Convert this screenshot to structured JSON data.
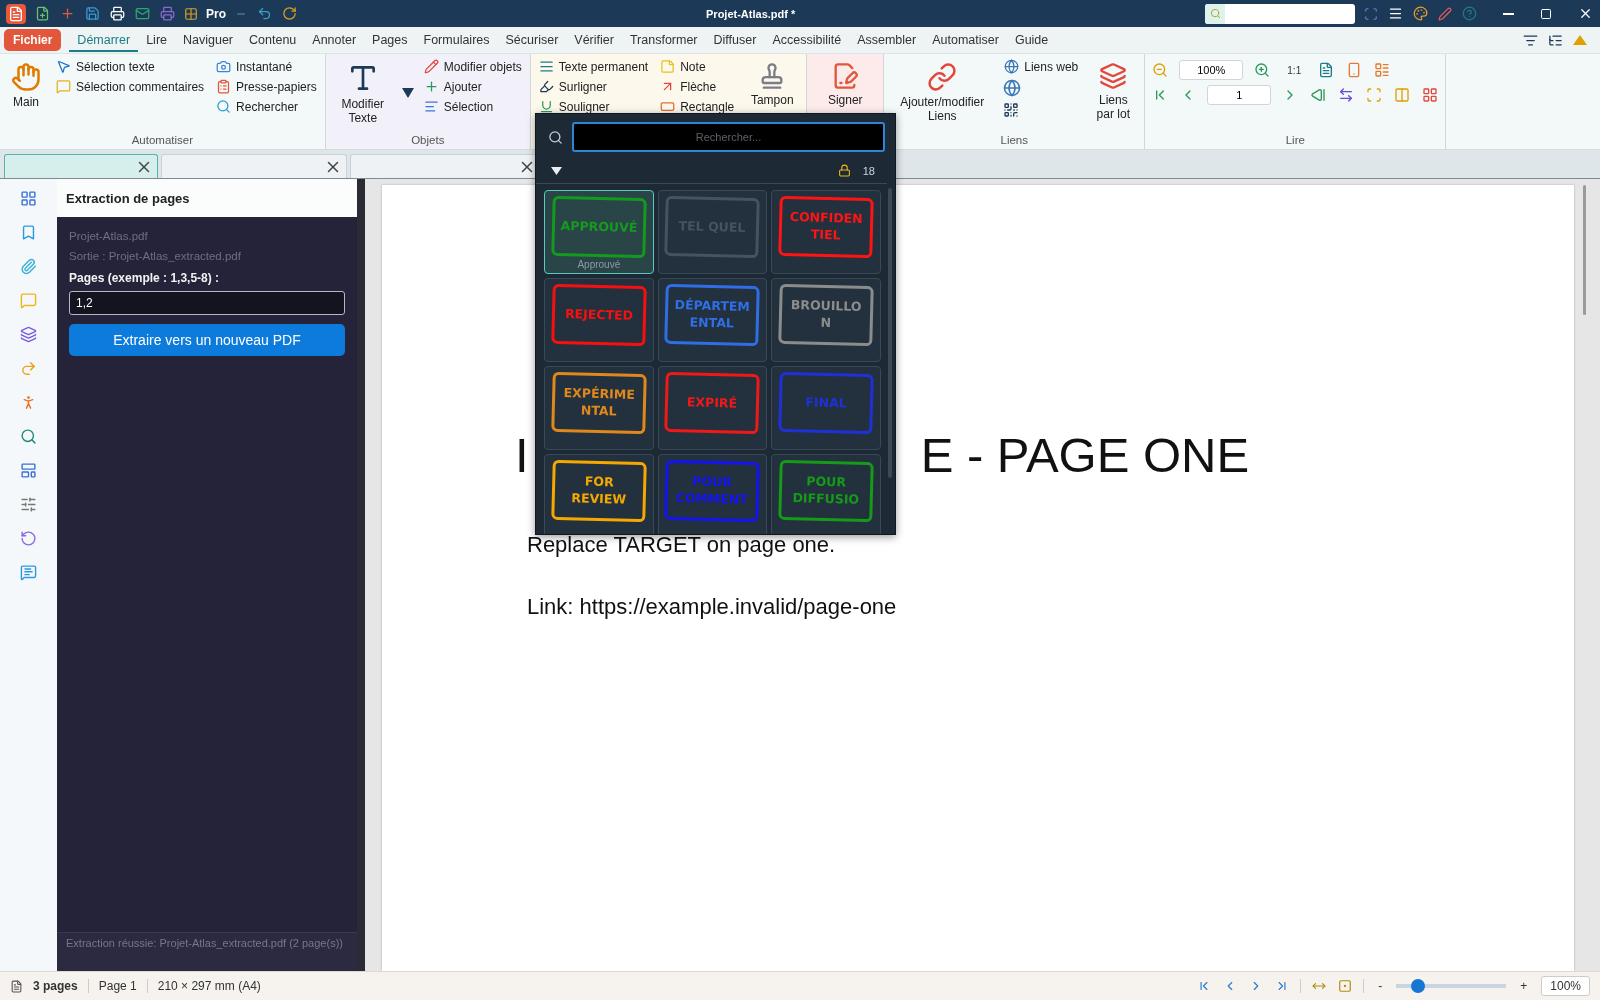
{
  "titlebar": {
    "edition": "Pro",
    "title": "Projet-Atlas.pdf *"
  },
  "menu": {
    "file_button": "Fichier",
    "items": [
      {
        "label": "Démarrer",
        "selected": true
      },
      {
        "label": "Lire",
        "selected": false
      },
      {
        "label": "Naviguer",
        "selected": false
      },
      {
        "label": "Contenu",
        "selected": false
      },
      {
        "label": "Annoter",
        "selected": false
      },
      {
        "label": "Pages",
        "selected": false
      },
      {
        "label": "Formulaires",
        "selected": false
      },
      {
        "label": "Sécuriser",
        "selected": false
      },
      {
        "label": "Vérifier",
        "selected": false
      },
      {
        "label": "Transformer",
        "selected": false
      },
      {
        "label": "Diffuser",
        "selected": false
      },
      {
        "label": "Accessibilité",
        "selected": false
      },
      {
        "label": "Assembler",
        "selected": false
      },
      {
        "label": "Automatiser",
        "selected": false
      },
      {
        "label": "Guide",
        "selected": false
      }
    ]
  },
  "ribbon": {
    "groups": [
      {
        "label": "Automatiser",
        "columns": [
          [
            {
              "kind": "large",
              "label": "Main"
            }
          ],
          [
            {
              "kind": "small",
              "label": "Sélection texte"
            },
            {
              "kind": "small",
              "label": "Sélection commentaires"
            }
          ],
          [
            {
              "kind": "small",
              "label": "Instantané"
            },
            {
              "kind": "small",
              "label": "Presse-papiers"
            },
            {
              "kind": "small",
              "label": "Rechercher"
            }
          ]
        ]
      },
      {
        "label": "Objets",
        "columns": [
          [
            {
              "kind": "large",
              "label": "Modifier Texte"
            }
          ],
          [
            {
              "kind": "dropdown"
            }
          ],
          [
            {
              "kind": "small",
              "label": "Modifier objets"
            },
            {
              "kind": "small",
              "label": "Ajouter"
            },
            {
              "kind": "small",
              "label": "Sélection"
            }
          ]
        ]
      },
      {
        "columns": [
          [
            {
              "kind": "small",
              "label": "Texte permanent"
            },
            {
              "kind": "small",
              "label": "Surligner"
            },
            {
              "kind": "small",
              "label": "Souligner"
            }
          ],
          [
            {
              "kind": "small",
              "label": "Note"
            },
            {
              "kind": "small",
              "label": "Flèche"
            },
            {
              "kind": "small",
              "label": "Rectangle"
            }
          ],
          [
            {
              "kind": "large",
              "label": "Tampon"
            }
          ]
        ]
      },
      {
        "columns": [
          [
            {
              "kind": "large",
              "label": "Signer"
            }
          ]
        ]
      },
      {
        "label": "Liens",
        "columns": [
          [
            {
              "kind": "large",
              "label": "Ajouter/modifier Liens"
            }
          ],
          [
            {
              "kind": "small",
              "label": "Liens web"
            },
            {
              "kind": "icon"
            },
            {
              "kind": "icon"
            }
          ],
          [
            {
              "kind": "large",
              "label": "Liens par lot"
            }
          ]
        ]
      },
      {
        "label": "Lire",
        "rows": [
          [
            {
              "kind": "icon"
            },
            {
              "kind": "field",
              "value": "100%"
            },
            {
              "kind": "icon"
            },
            {
              "kind": "text",
              "label": "1:1"
            },
            {
              "kind": "icon"
            },
            {
              "kind": "icon"
            },
            {
              "kind": "icon"
            }
          ],
          [
            {
              "kind": "icon"
            },
            {
              "kind": "icon"
            },
            {
              "kind": "field",
              "value": "1"
            },
            {
              "kind": "icon"
            },
            {
              "kind": "icon"
            },
            {
              "kind": "icon"
            },
            {
              "kind": "icon"
            },
            {
              "kind": "icon"
            },
            {
              "kind": "icon"
            }
          ]
        ]
      }
    ]
  },
  "doc_tabs": [
    {
      "selected": true
    },
    {
      "selected": false
    },
    {
      "selected": false
    }
  ],
  "panel": {
    "title": "Extraction de pages",
    "file": "Projet-Atlas.pdf",
    "output": "Sortie : Projet-Atlas_extracted.pdf",
    "pages_label": "Pages (exemple : 1,3,5-8) :",
    "pages_value": "1,2",
    "button": "Extraire vers un nouveau PDF",
    "status": "Extraction réussie: Projet-Atlas_extracted.pdf (2 page(s))"
  },
  "document": {
    "heading_left": "I",
    "heading_right": "E - PAGE ONE",
    "body": "Replace TARGET on page one.",
    "link": "Link: https://example.invalid/page-one"
  },
  "stamp_picker": {
    "placeholder": "Rechercher...",
    "count": "18",
    "stamps": [
      {
        "lines": [
          "APPROUVÉ"
        ],
        "color": "#149a1e",
        "selected": true,
        "caption": "Approuvé"
      },
      {
        "lines": [
          "TEL QUEL"
        ],
        "color": "#47525c",
        "selected": false
      },
      {
        "lines": [
          "CONFIDEN",
          "TIEL"
        ],
        "color": "#ff1414",
        "selected": false
      },
      {
        "lines": [
          "REJECTED"
        ],
        "color": "#f81010",
        "selected": false
      },
      {
        "lines": [
          "DÉPARTEM",
          "ENTAL"
        ],
        "color": "#2f6ee6",
        "selected": false
      },
      {
        "lines": [
          "BROUILLO",
          "N"
        ],
        "color": "#8c8c8c",
        "selected": false
      },
      {
        "lines": [
          "EXPÉRIME",
          "NTAL"
        ],
        "color": "#e0881c",
        "selected": false
      },
      {
        "lines": [
          "EXPIRÉ"
        ],
        "color": "#f01818",
        "selected": false
      },
      {
        "lines": [
          "FINAL"
        ],
        "color": "#2030d8",
        "selected": false
      },
      {
        "lines": [
          "FOR",
          "REVIEW"
        ],
        "color": "#f5a800",
        "selected": false
      },
      {
        "lines": [
          "POUR",
          "COMMENT"
        ],
        "color": "#1414f0",
        "selected": false
      },
      {
        "lines": [
          "POUR",
          "DIFFUSIO"
        ],
        "color": "#169a1a",
        "selected": false
      }
    ]
  },
  "status_bar": {
    "pages": "3 pages",
    "page": "Page 1",
    "size": "210 × 297 mm (A4)",
    "zoom_minus": "-",
    "zoom_plus": "+",
    "zoom_slider": {
      "level": 0.2
    },
    "zoom": "100%"
  }
}
